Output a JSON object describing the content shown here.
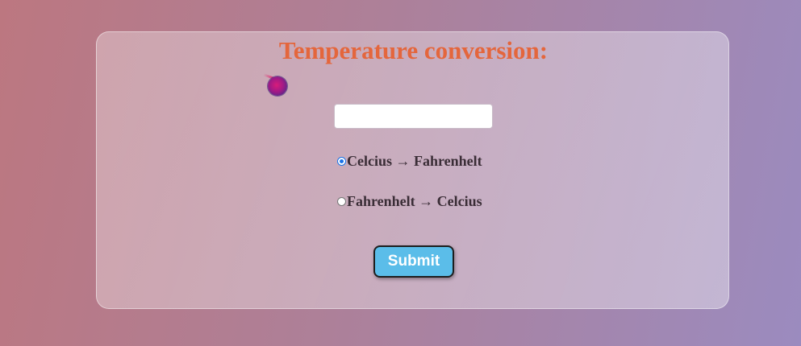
{
  "form": {
    "title": "Temperature conversion:",
    "temperature_input": {
      "value": "",
      "placeholder": ""
    },
    "options": [
      {
        "label": "Celcius → Fahrenhelt",
        "checked": true
      },
      {
        "label": "Fahrenhelt → Celcius",
        "checked": false
      }
    ],
    "submit_label": "Submit"
  },
  "icons": {
    "orb": "comet-ball-icon"
  },
  "colors": {
    "title": "#e4663c",
    "submit_bg": "#5bbde9",
    "radio_accent": "#1a73e8"
  }
}
